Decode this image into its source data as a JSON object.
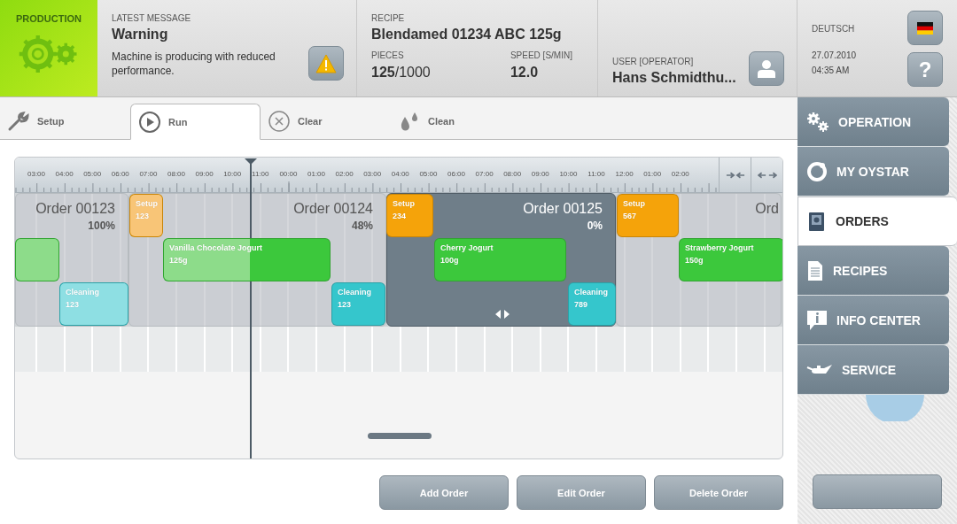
{
  "production": {
    "label": "PRODUCTION"
  },
  "message": {
    "label": "LATEST MESSAGE",
    "title": "Warning",
    "text": "Machine is producing with reduced performance."
  },
  "recipe": {
    "label": "RECIPE",
    "name": "Blendamed 01234 ABC 125g",
    "pieces_label": "PIECES",
    "pieces_done": "125",
    "pieces_total": "/1000",
    "speed_label": "SPEED [S/MIN]",
    "speed": "12.0"
  },
  "user": {
    "label": "USER [OPERATOR]",
    "name": "Hans Schmidthu..."
  },
  "language": {
    "label": "DEUTSCH",
    "date": "27.07.2010",
    "time": "04:35 AM",
    "help": "?"
  },
  "tabs": [
    {
      "label": "Setup",
      "selected": false
    },
    {
      "label": "Run",
      "selected": true
    },
    {
      "label": "Clear",
      "selected": false
    },
    {
      "label": "Clean",
      "selected": false
    }
  ],
  "timeline": {
    "hours": [
      "03:00",
      "04:00",
      "05:00",
      "06:00",
      "07:00",
      "08:00",
      "09:00",
      "10:00",
      "11:00",
      "00:00",
      "01:00",
      "02:00",
      "03:00",
      "04:00",
      "05:00",
      "06:00",
      "07:00",
      "08:00",
      "09:00",
      "10:00",
      "11:00",
      "12:00",
      "01:00",
      "02:00"
    ],
    "orders": [
      {
        "title": "Order 00123",
        "progress": "100%",
        "selected": false
      },
      {
        "title": "Order 00124",
        "progress": "48%",
        "selected": false
      },
      {
        "title": "Order 00125",
        "progress": "0%",
        "selected": true
      },
      {
        "title": "Ord",
        "selected": false
      }
    ],
    "blocks": [
      {
        "kind": "setup",
        "name": "Setup",
        "amount": "123",
        "level": 1
      },
      {
        "kind": "setup",
        "name": "Setup",
        "amount": "234",
        "level": 0
      },
      {
        "kind": "setup",
        "name": "Setup",
        "amount": "567",
        "level": 0
      },
      {
        "kind": "product",
        "level": 1
      },
      {
        "kind": "product",
        "name": "Vanilla Chocolate Jogurt",
        "amount": "125g",
        "level": 0.52
      },
      {
        "kind": "product",
        "name": "Cherry Jogurt",
        "amount": "100g",
        "level": 0
      },
      {
        "kind": "product",
        "name": "Strawberry Jogurt",
        "amount": "150g",
        "level": 0
      },
      {
        "kind": "cleaning",
        "name": "Cleaning",
        "amount": "123",
        "level": 1
      },
      {
        "kind": "cleaning",
        "name": "Cleaning",
        "amount": "123",
        "level": 0
      },
      {
        "kind": "cleaning",
        "name": "Cleaning",
        "amount": "789",
        "level": 0
      }
    ]
  },
  "actions": [
    "Add Order",
    "Edit Order",
    "Delete Order"
  ],
  "sidebar": {
    "items": [
      {
        "label": "OPERATION",
        "selected": false
      },
      {
        "label": "MY OYSTAR",
        "selected": false
      },
      {
        "label": "ORDERS",
        "selected": true
      },
      {
        "label": "RECIPES",
        "selected": false
      },
      {
        "label": "INFO CENTER",
        "selected": false
      },
      {
        "label": "SERVICE",
        "selected": false
      }
    ]
  }
}
